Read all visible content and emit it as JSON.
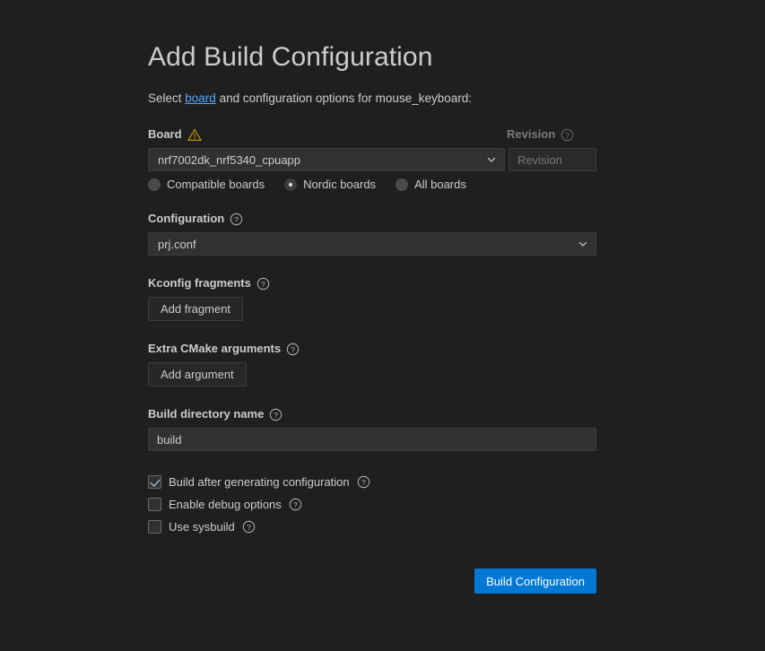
{
  "page": {
    "title": "Add Build Configuration",
    "background_color": "#1f1f1f"
  },
  "intro": {
    "prefix": "Select ",
    "link": "board",
    "suffix": " and configuration options for mouse_keyboard:"
  },
  "board": {
    "label": "Board",
    "warning_icon": "warning-triangle-icon",
    "select_value": "nrf7002dk_nrf5340_cpuapp",
    "chevron_icon": "chevron-down-icon",
    "filters": [
      {
        "label": "Compatible boards",
        "selected": false
      },
      {
        "label": "Nordic boards",
        "selected": true
      },
      {
        "label": "All boards",
        "selected": false
      }
    ]
  },
  "revision": {
    "label": "Revision",
    "help_icon": "help-circle-icon",
    "placeholder": "Revision",
    "value": "",
    "disabled": true
  },
  "configuration": {
    "label": "Configuration",
    "help_icon": "help-circle-icon",
    "select_value": "prj.conf",
    "chevron_icon": "chevron-down-icon"
  },
  "kconfig_fragments": {
    "label": "Kconfig fragments",
    "help_icon": "help-circle-icon",
    "button_label": "Add fragment"
  },
  "extra_cmake_arguments": {
    "label": "Extra CMake arguments",
    "help_icon": "help-circle-icon",
    "button_label": "Add argument"
  },
  "build_directory": {
    "label": "Build directory name",
    "help_icon": "help-circle-icon",
    "value": "build",
    "placeholder": ""
  },
  "options": [
    {
      "label": "Build after generating configuration",
      "checked": true,
      "help_icon": "help-circle-icon"
    },
    {
      "label": "Enable debug options",
      "checked": false,
      "help_icon": "help-circle-icon"
    },
    {
      "label": "Use sysbuild",
      "checked": false,
      "help_icon": "help-circle-icon"
    }
  ],
  "footer": {
    "submit_label": "Build Configuration",
    "submit_color": "#0078d4"
  }
}
